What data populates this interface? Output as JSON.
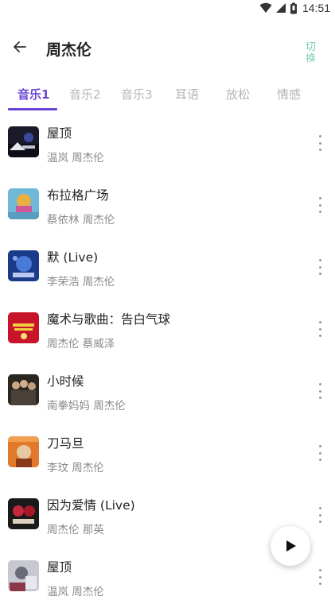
{
  "status_bar": {
    "time": "14:51"
  },
  "header": {
    "title": "周杰伦",
    "switch_label": "切换"
  },
  "tabs": [
    {
      "label": "音乐1",
      "active": true
    },
    {
      "label": "音乐2",
      "active": false
    },
    {
      "label": "音乐3",
      "active": false
    },
    {
      "label": "耳语",
      "active": false
    },
    {
      "label": "放松",
      "active": false
    },
    {
      "label": "情感",
      "active": false
    }
  ],
  "songs": [
    {
      "title": "屋顶",
      "artist": "温岚 周杰伦"
    },
    {
      "title": "布拉格广场",
      "artist": "蔡依林 周杰伦"
    },
    {
      "title": "默 (Live)",
      "artist": "李荣浩 周杰伦"
    },
    {
      "title": "魔术与歌曲：告白气球",
      "artist": "周杰伦 蔡威泽"
    },
    {
      "title": "小时候",
      "artist": "南拳妈妈 周杰伦"
    },
    {
      "title": "刀马旦",
      "artist": "李玟 周杰伦"
    },
    {
      "title": "因为爱情 (Live)",
      "artist": "周杰伦 那英"
    },
    {
      "title": "屋顶",
      "artist": "温岚 周杰伦"
    }
  ],
  "colors": {
    "accent": "#6b46d6",
    "switch": "#7ccfae"
  },
  "icons": {
    "back": "arrow-left-icon",
    "more": "more-vertical-icon",
    "play": "play-icon"
  }
}
